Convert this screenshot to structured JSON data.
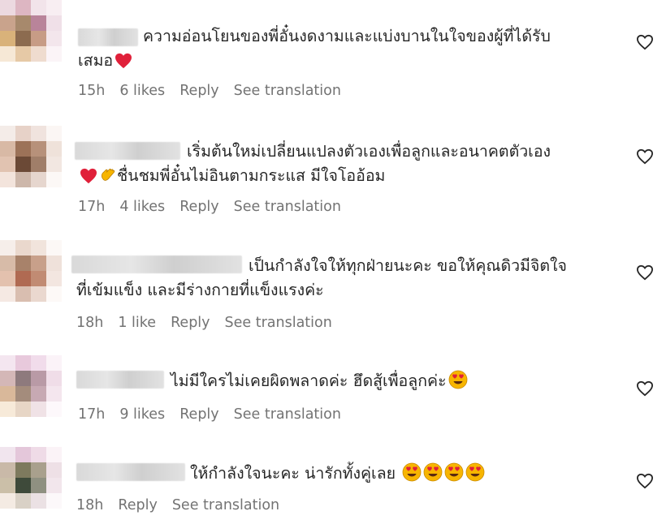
{
  "comments": [
    {
      "line1": "ความอ่อนโยนของพี่อั๋นงดงามและแบ่งบานในใจของผู้ที่ได้รับ",
      "line2": "เสมอ",
      "emojis_line2": [
        "red-heart"
      ],
      "time": "15h",
      "likes": "6 likes",
      "reply": "Reply",
      "translate": "See translation"
    },
    {
      "line1": "เริ่มต้นใหม่เปลี่ยนแปลงตัวเองเพื่อลูกและอนาคตตัวเอง",
      "line2": "ชื่นชมพี่อั๋นไม่อินตามกระแส มีใจโออ้อม",
      "emojis_line2_prefix": [
        "red-heart",
        "clapping-hands"
      ],
      "time": "17h",
      "likes": "4 likes",
      "reply": "Reply",
      "translate": "See translation"
    },
    {
      "line1": "เป็นกำลังใจให้ทุกฝ่ายนะคะ ขอให้คุณดิวมีจิตใจ",
      "line2": "ที่เข้มแข็ง และมีร่างกายที่แข็งแรงค่ะ",
      "time": "18h",
      "likes": "1 like",
      "reply": "Reply",
      "translate": "See translation"
    },
    {
      "line1": "ไม่มีใครไม่เคยผิดพลาดค่ะ ฮึดสู้เพื่อลูกค่ะ",
      "emojis_line1": [
        "heart-eyes"
      ],
      "time": "17h",
      "likes": "9 likes",
      "reply": "Reply",
      "translate": "See translation"
    },
    {
      "line1": "ให้กำลังใจนะคะ น่ารักทั้งคู่เลย",
      "emojis_line1": [
        "heart-eyes",
        "heart-eyes",
        "heart-eyes",
        "heart-eyes"
      ],
      "time": "18h",
      "reply": "Reply",
      "translate": "See translation"
    }
  ],
  "colors": {
    "text": "#262626",
    "meta": "#737373",
    "heart_emoji": "#e0203a",
    "face_emoji": "#f7b500"
  },
  "icons": {
    "like": "heart-outline-icon"
  }
}
